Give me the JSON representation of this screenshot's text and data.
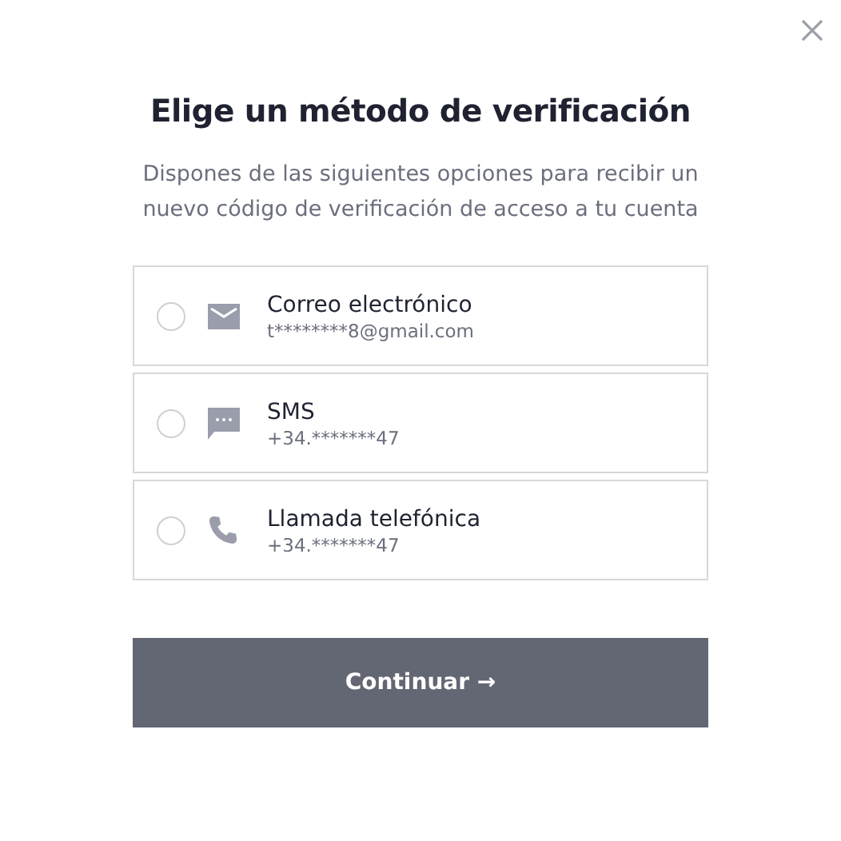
{
  "title": "Elige un método de verificación",
  "subtitle": "Dispones de las siguientes opciones para recibir un nuevo código de verificación de acceso a tu cuenta",
  "options": [
    {
      "kind": "email",
      "label": "Correo electrónico",
      "detail": "t********8@gmail.com",
      "selected": false
    },
    {
      "kind": "sms",
      "label": "SMS",
      "detail": "+34.*******47",
      "selected": false
    },
    {
      "kind": "phone",
      "label": "Llamada telefónica",
      "detail": "+34.*******47",
      "selected": false
    }
  ],
  "button": "Continuar →"
}
